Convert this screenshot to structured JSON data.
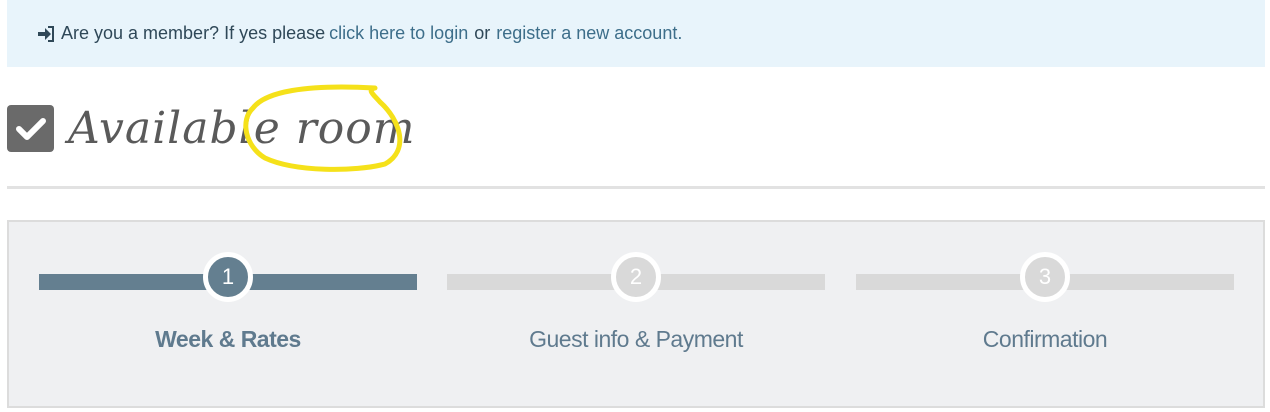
{
  "login_bar": {
    "prompt": "Are you a member? If yes please",
    "login_link": "click here to login",
    "or_text": "or",
    "register_link": "register a new account."
  },
  "heading": {
    "title": "Available room"
  },
  "steps": [
    {
      "number": "1",
      "label": "Week & Rates",
      "active": true
    },
    {
      "number": "2",
      "label": "Guest info & Payment",
      "active": false
    },
    {
      "number": "3",
      "label": "Confirmation",
      "active": false
    }
  ],
  "colors": {
    "active": "#647f90",
    "inactive": "#d9d9d9",
    "annotation": "#f5e11a"
  }
}
